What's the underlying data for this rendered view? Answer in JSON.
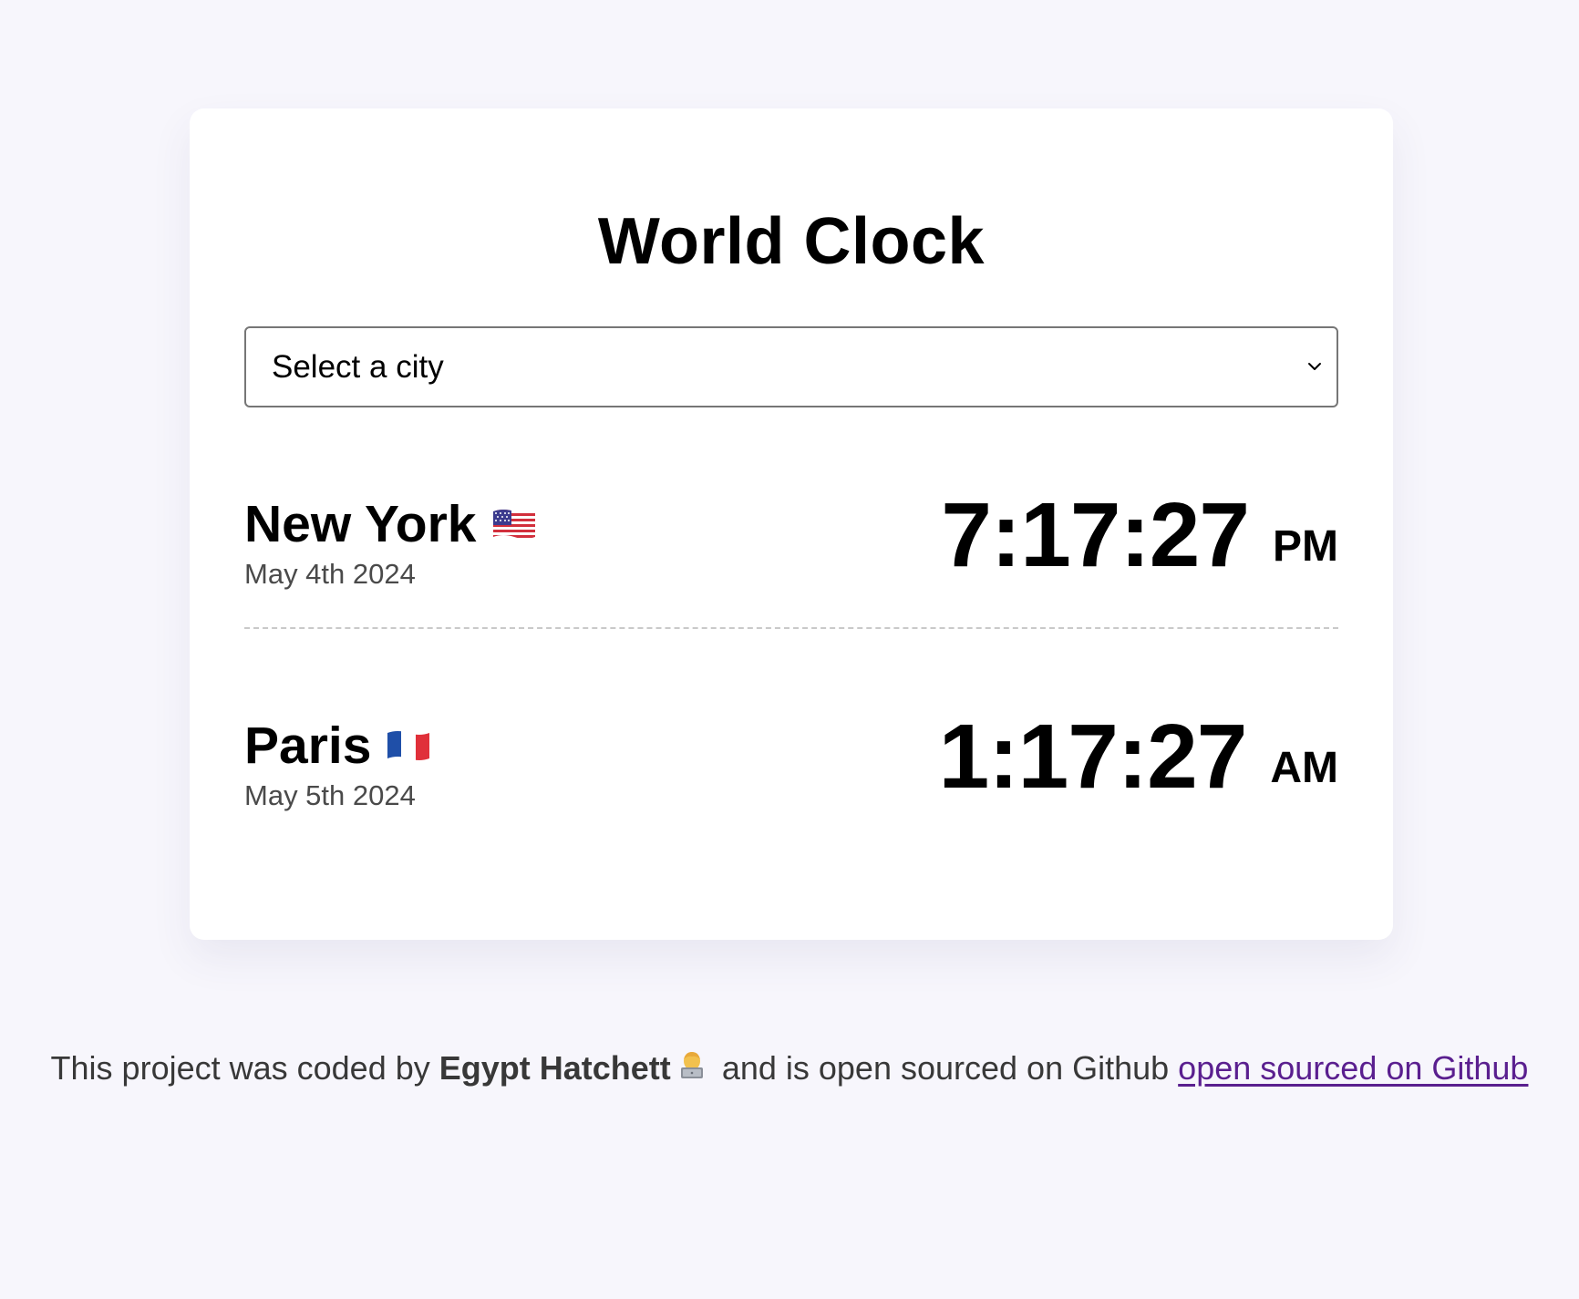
{
  "app": {
    "title": "World Clock"
  },
  "city_select": {
    "selected_label": "Select a city",
    "icon": "chevron-down-icon"
  },
  "cities": [
    {
      "name": "New York",
      "flag": "us-flag-icon",
      "date": "May 4th 2024",
      "time": "7:17:27",
      "ampm": "PM"
    },
    {
      "name": "Paris",
      "flag": "france-flag-icon",
      "date": "May 5th 2024",
      "time": "1:17:27",
      "ampm": "AM"
    }
  ],
  "footer": {
    "text_before": "This project was coded by",
    "author": "Egypt Hatchett",
    "author_icon": "technologist-icon",
    "text_middle": "and is open sourced on Github",
    "link_text": "open sourced on Github"
  },
  "colors": {
    "page_background": "#f7f6fc",
    "card_background": "#ffffff",
    "link": "#5a1f8f",
    "date_text": "#4a4a4a",
    "divider": "#c9c9c9"
  }
}
